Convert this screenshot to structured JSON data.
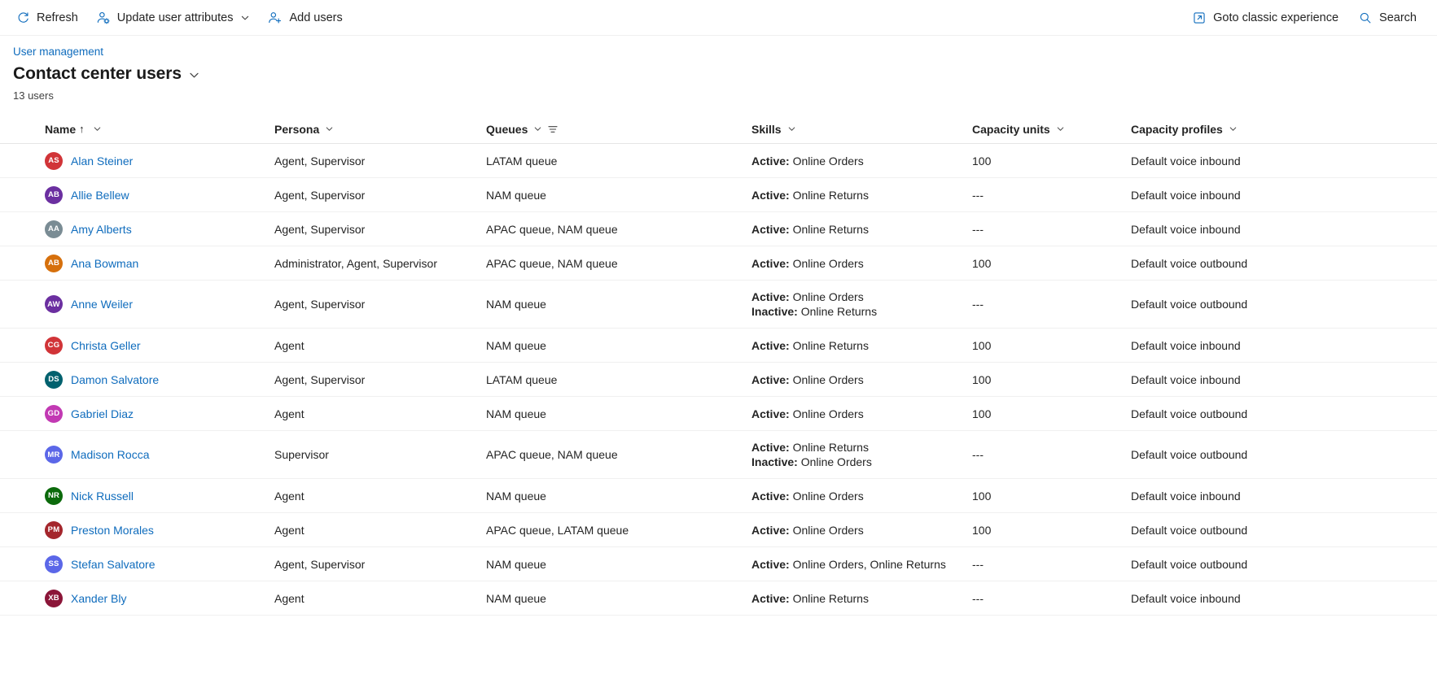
{
  "commandbar": {
    "left_items": [
      {
        "label": "Refresh",
        "icon": "refresh-icon",
        "has_chevron": false
      },
      {
        "label": "Update user attributes",
        "icon": "person-settings-icon",
        "has_chevron": true
      },
      {
        "label": "Add users",
        "icon": "person-add-icon",
        "has_chevron": false
      }
    ],
    "right_items": [
      {
        "label": "Goto classic experience",
        "icon": "open-external-icon"
      },
      {
        "label": "Search",
        "icon": "search-icon"
      }
    ]
  },
  "header": {
    "breadcrumb": "User management",
    "title": "Contact center users",
    "title_chevron": "chevron-down-icon",
    "count": "13 users"
  },
  "colors": {
    "accent": "#0f6cbd",
    "text": "#242424",
    "border": "#f0f0f0",
    "header_border": "#e5e5e5"
  },
  "table": {
    "columns": [
      {
        "key": "name",
        "label": "Name",
        "sorted": true,
        "sort_arrow": "↑",
        "has_chevron": true,
        "has_filter": false
      },
      {
        "key": "persona",
        "label": "Persona",
        "sorted": false,
        "sort_arrow": "",
        "has_chevron": true,
        "has_filter": false
      },
      {
        "key": "queues",
        "label": "Queues",
        "sorted": false,
        "sort_arrow": "",
        "has_chevron": true,
        "has_filter": true
      },
      {
        "key": "skills",
        "label": "Skills",
        "sorted": false,
        "sort_arrow": "",
        "has_chevron": true,
        "has_filter": false
      },
      {
        "key": "capacity_units",
        "label": "Capacity units",
        "sorted": false,
        "sort_arrow": "",
        "has_chevron": true,
        "has_filter": false
      },
      {
        "key": "capacity_profiles",
        "label": "Capacity profiles",
        "sorted": false,
        "sort_arrow": "",
        "has_chevron": true,
        "has_filter": false
      }
    ],
    "rows": [
      {
        "initials": "AS",
        "avatar_color": "#d13438",
        "name": "Alan Steiner",
        "persona": "Agent, Supervisor",
        "queues": "LATAM queue",
        "skills": [
          {
            "state": "Active:",
            "value": "Online Orders"
          }
        ],
        "capacity_units": "100",
        "capacity_profiles": "Default voice inbound"
      },
      {
        "initials": "AB",
        "avatar_color": "#6b2fa0",
        "name": "Allie Bellew",
        "persona": "Agent, Supervisor",
        "queues": "NAM queue",
        "skills": [
          {
            "state": "Active:",
            "value": "Online Returns"
          }
        ],
        "capacity_units": "---",
        "capacity_profiles": "Default voice inbound"
      },
      {
        "initials": "AA",
        "avatar_color": "#7a8c94",
        "name": "Amy Alberts",
        "persona": "Agent, Supervisor",
        "queues": "APAC queue, NAM queue",
        "skills": [
          {
            "state": "Active:",
            "value": "Online Returns"
          }
        ],
        "capacity_units": "---",
        "capacity_profiles": "Default voice inbound"
      },
      {
        "initials": "AB",
        "avatar_color": "#d6700c",
        "name": "Ana Bowman",
        "persona": "Administrator, Agent, Supervisor",
        "queues": "APAC queue, NAM queue",
        "skills": [
          {
            "state": "Active:",
            "value": "Online Orders"
          }
        ],
        "capacity_units": "100",
        "capacity_profiles": "Default voice outbound"
      },
      {
        "initials": "AW",
        "avatar_color": "#6b2fa0",
        "name": "Anne Weiler",
        "persona": "Agent, Supervisor",
        "queues": "NAM queue",
        "skills": [
          {
            "state": "Active:",
            "value": "Online Orders"
          },
          {
            "state": "Inactive:",
            "value": "Online Returns"
          }
        ],
        "capacity_units": "---",
        "capacity_profiles": "Default voice outbound"
      },
      {
        "initials": "CG",
        "avatar_color": "#d13438",
        "name": "Christa Geller",
        "persona": "Agent",
        "queues": "NAM queue",
        "skills": [
          {
            "state": "Active:",
            "value": "Online Returns"
          }
        ],
        "capacity_units": "100",
        "capacity_profiles": "Default voice inbound"
      },
      {
        "initials": "DS",
        "avatar_color": "#00616e",
        "name": "Damon Salvatore",
        "persona": "Agent, Supervisor",
        "queues": "LATAM queue",
        "skills": [
          {
            "state": "Active:",
            "value": "Online Orders"
          }
        ],
        "capacity_units": "100",
        "capacity_profiles": "Default voice inbound"
      },
      {
        "initials": "GD",
        "avatar_color": "#c239b3",
        "name": "Gabriel Diaz",
        "persona": "Agent",
        "queues": "NAM queue",
        "skills": [
          {
            "state": "Active:",
            "value": "Online Orders"
          }
        ],
        "capacity_units": "100",
        "capacity_profiles": "Default voice outbound"
      },
      {
        "initials": "MR",
        "avatar_color": "#5b67e8",
        "name": "Madison Rocca",
        "persona": "Supervisor",
        "queues": "APAC queue, NAM queue",
        "skills": [
          {
            "state": "Active:",
            "value": "Online Returns"
          },
          {
            "state": "Inactive:",
            "value": "Online Orders"
          }
        ],
        "capacity_units": "---",
        "capacity_profiles": "Default voice outbound"
      },
      {
        "initials": "NR",
        "avatar_color": "#0b6a0b",
        "name": "Nick Russell",
        "persona": "Agent",
        "queues": "NAM queue",
        "skills": [
          {
            "state": "Active:",
            "value": "Online Orders"
          }
        ],
        "capacity_units": "100",
        "capacity_profiles": "Default voice inbound"
      },
      {
        "initials": "PM",
        "avatar_color": "#a4262c",
        "name": "Preston Morales",
        "persona": "Agent",
        "queues": "APAC queue, LATAM queue",
        "skills": [
          {
            "state": "Active:",
            "value": "Online Orders"
          }
        ],
        "capacity_units": "100",
        "capacity_profiles": "Default voice outbound"
      },
      {
        "initials": "SS",
        "avatar_color": "#5b67e8",
        "name": "Stefan Salvatore",
        "persona": "Agent, Supervisor",
        "queues": "NAM queue",
        "skills": [
          {
            "state": "Active:",
            "value": "Online Orders, Online Returns"
          }
        ],
        "capacity_units": "---",
        "capacity_profiles": "Default voice outbound"
      },
      {
        "initials": "XB",
        "avatar_color": "#8b1538",
        "name": "Xander Bly",
        "persona": "Agent",
        "queues": "NAM queue",
        "skills": [
          {
            "state": "Active:",
            "value": "Online Returns"
          }
        ],
        "capacity_units": "---",
        "capacity_profiles": "Default voice inbound"
      }
    ]
  }
}
